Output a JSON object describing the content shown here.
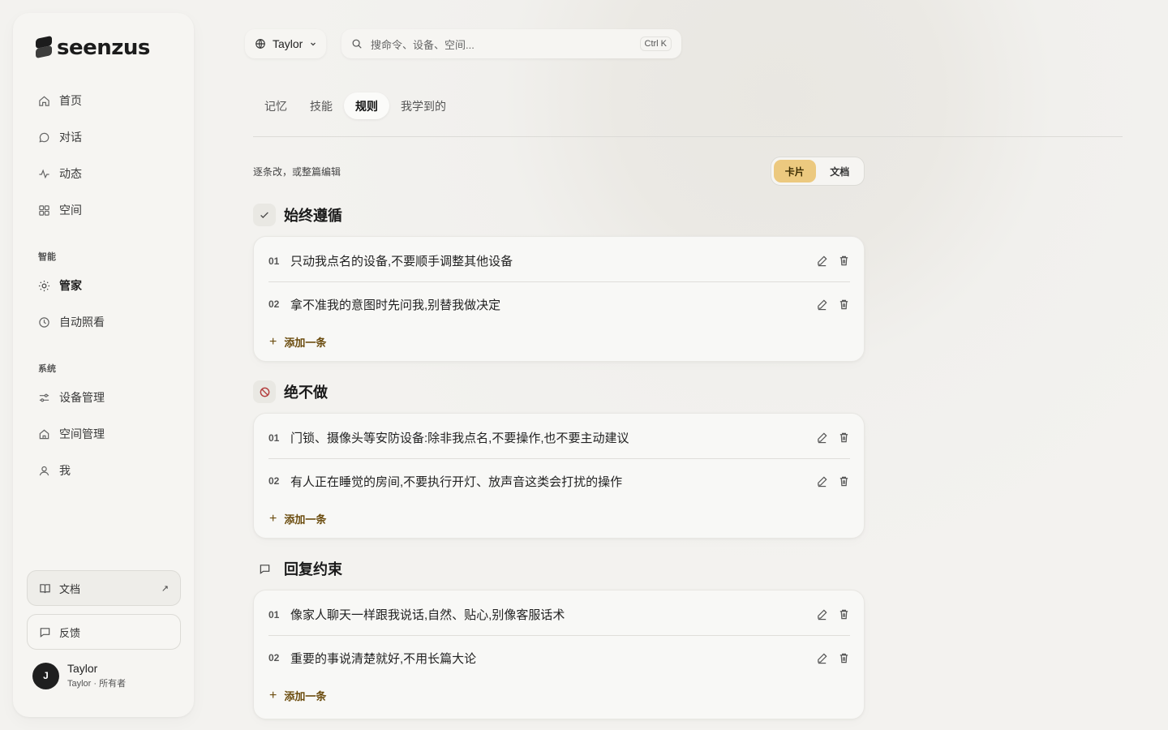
{
  "brand": {
    "name": "seenzus"
  },
  "nav": {
    "items": [
      {
        "label": "首页",
        "icon": "home-icon"
      },
      {
        "label": "对话",
        "icon": "chat-icon"
      },
      {
        "label": "动态",
        "icon": "activity-icon"
      },
      {
        "label": "空间",
        "icon": "grid-icon"
      }
    ],
    "section_intelligence": "智能",
    "intelligence_items": [
      {
        "label": "管家",
        "icon": "sun-icon",
        "active": true
      },
      {
        "label": "自动照看",
        "icon": "clock-icon"
      }
    ],
    "section_system": "系统",
    "system_items": [
      {
        "label": "设备管理",
        "icon": "sliders-icon"
      },
      {
        "label": "空间管理",
        "icon": "house-icon"
      },
      {
        "label": "我",
        "icon": "user-icon"
      }
    ]
  },
  "sidebar_footer": {
    "docs_label": "文档",
    "docs_arrow": "↗",
    "feedback_label": "反馈"
  },
  "user": {
    "initial": "J",
    "name": "Taylor",
    "subtitle": "Taylor · 所有者"
  },
  "header": {
    "workspace": "Taylor",
    "search_placeholder": "搜命令、设备、空间...",
    "search_shortcut": "Ctrl K"
  },
  "tabs": [
    {
      "label": "记忆"
    },
    {
      "label": "技能"
    },
    {
      "label": "规则",
      "active": true
    },
    {
      "label": "我学到的"
    }
  ],
  "hint": "逐条改，或整篇编辑",
  "view_toggle": {
    "card": "卡片",
    "doc": "文档",
    "selected": "卡片"
  },
  "sections": [
    {
      "title": "始终遵循",
      "icon": "check-icon",
      "rules": [
        {
          "num": "01",
          "text": "只动我点名的设备,不要顺手调整其他设备"
        },
        {
          "num": "02",
          "text": "拿不准我的意图时先问我,别替我做决定"
        }
      ],
      "add_label": "添加一条"
    },
    {
      "title": "绝不做",
      "icon": "prohibited-icon",
      "rules": [
        {
          "num": "01",
          "text": "门锁、摄像头等安防设备:除非我点名,不要操作,也不要主动建议"
        },
        {
          "num": "02",
          "text": "有人正在睡觉的房间,不要执行开灯、放声音这类会打扰的操作"
        }
      ],
      "add_label": "添加一条"
    },
    {
      "title": "回复约束",
      "icon": "message-icon",
      "rules": [
        {
          "num": "01",
          "text": "像家人聊天一样跟我说话,自然、贴心,别像客服话术"
        },
        {
          "num": "02",
          "text": "重要的事说清楚就好,不用长篇大论"
        }
      ],
      "add_label": "添加一条"
    }
  ],
  "colors": {
    "accent": "#ecc97f",
    "add_link": "#6b4c0e",
    "prohibit": "#b23a3a"
  }
}
